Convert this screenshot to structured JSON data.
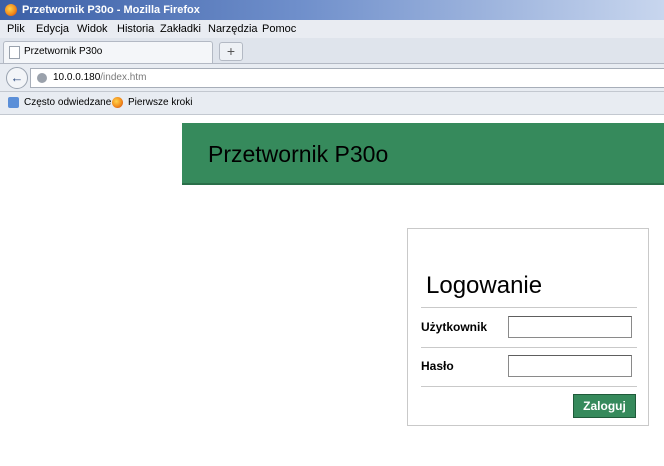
{
  "window": {
    "title": "Przetwornik P30o - Mozilla Firefox"
  },
  "menu": {
    "items": [
      "Plik",
      "Edycja",
      "Widok",
      "Historia",
      "Zakładki",
      "Narzędzia",
      "Pomoc"
    ]
  },
  "tabs": {
    "active_label": "Przetwornik P30o",
    "new_tab_label": "+"
  },
  "navigation": {
    "back_symbol": "←",
    "url_host": "10.0.0.180",
    "url_path": "/index.htm"
  },
  "bookmarks": {
    "items": [
      "Często odwiedzane",
      "Pierwsze kroki"
    ]
  },
  "page": {
    "title": "Przetwornik P30o",
    "login": {
      "heading": "Logowanie",
      "user_label": "Użytkownik",
      "user_value": "",
      "password_label": "Hasło",
      "password_value": "",
      "submit_label": "Zaloguj"
    }
  },
  "colors": {
    "brand_green": "#368a5c",
    "titlebar_blue": "#3b5fa6"
  }
}
